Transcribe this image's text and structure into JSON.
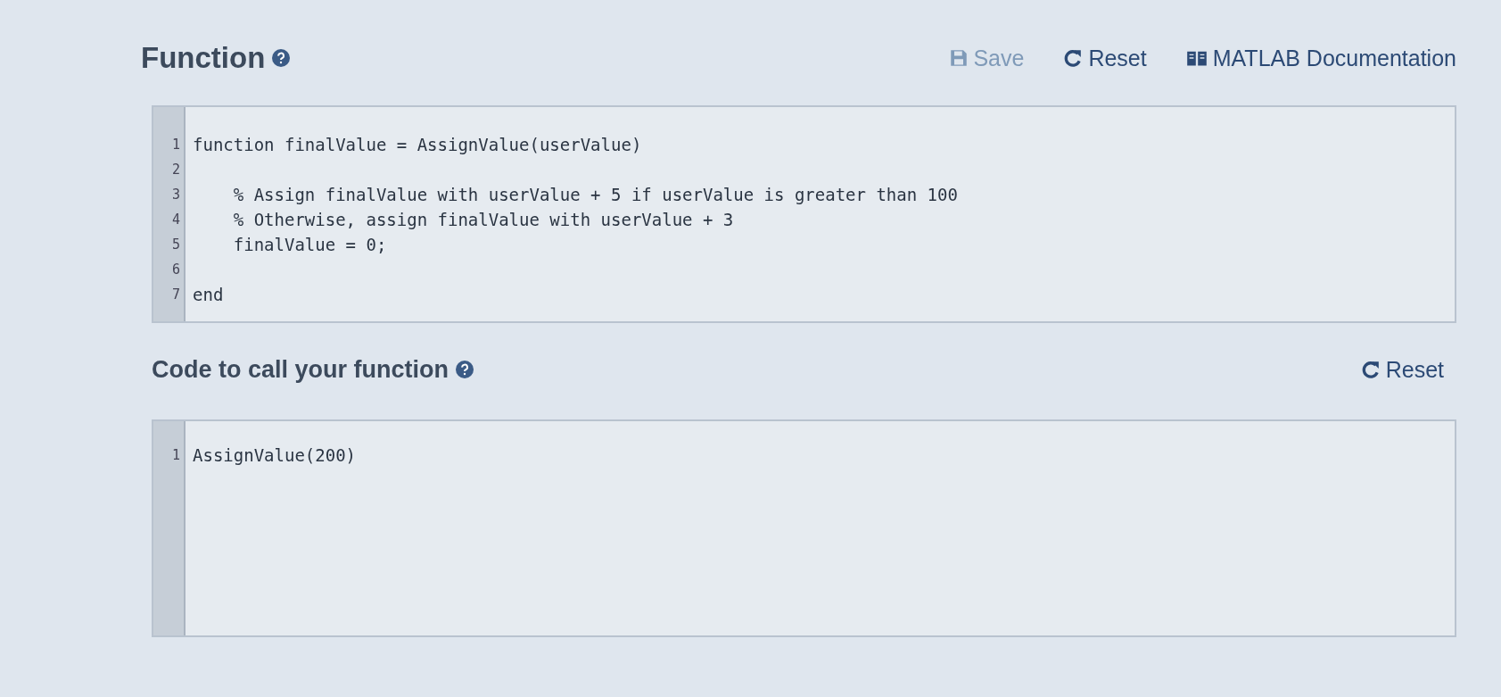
{
  "function_section": {
    "title": "Function",
    "actions": [
      {
        "kind": "save",
        "label": "Save",
        "disabled": true
      },
      {
        "kind": "reset",
        "label": "Reset",
        "disabled": false
      },
      {
        "kind": "docs",
        "label": "MATLAB Documentation",
        "disabled": false
      }
    ],
    "editor": {
      "lines": [
        {
          "number": "1",
          "code": "function finalValue = AssignValue(userValue)"
        },
        {
          "number": "2"
        },
        {
          "number": "3",
          "code": "    % Assign finalValue with userValue + 5 if userValue is greater than 100"
        },
        {
          "number": "4",
          "code": "    % Otherwise, assign finalValue with userValue + 3"
        },
        {
          "number": "5",
          "code": "    finalValue = 0;"
        },
        {
          "number": "6"
        },
        {
          "number": "7",
          "code": "end"
        }
      ]
    }
  },
  "call_section": {
    "title": "Code to call your function",
    "actions": [
      {
        "kind": "reset",
        "label": "Reset",
        "disabled": false
      }
    ],
    "editor": {
      "lines": [
        {
          "number": "1",
          "code": "AssignValue(200)"
        }
      ]
    }
  }
}
